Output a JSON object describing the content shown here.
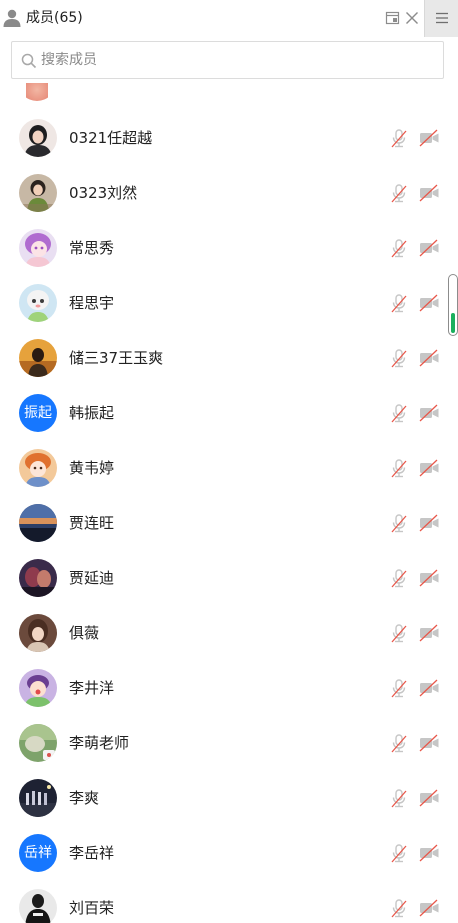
{
  "header": {
    "title": "成员(65)"
  },
  "search": {
    "placeholder": "搜索成员"
  },
  "members": [
    {
      "name": "0321任超越",
      "avatar_text": "",
      "mic_muted": true,
      "camera_off": true
    },
    {
      "name": "0323刘然",
      "avatar_text": "",
      "mic_muted": true,
      "camera_off": true
    },
    {
      "name": "常思秀",
      "avatar_text": "",
      "mic_muted": true,
      "camera_off": true
    },
    {
      "name": "程思宇",
      "avatar_text": "",
      "mic_muted": true,
      "camera_off": true
    },
    {
      "name": "储三37王玉爽",
      "avatar_text": "",
      "mic_muted": true,
      "camera_off": true
    },
    {
      "name": "韩振起",
      "avatar_text": "振起",
      "mic_muted": true,
      "camera_off": true
    },
    {
      "name": "黄韦婷",
      "avatar_text": "",
      "mic_muted": true,
      "camera_off": true
    },
    {
      "name": "贾连旺",
      "avatar_text": "",
      "mic_muted": true,
      "camera_off": true
    },
    {
      "name": "贾延迪",
      "avatar_text": "",
      "mic_muted": true,
      "camera_off": true
    },
    {
      "name": "俱薇",
      "avatar_text": "",
      "mic_muted": true,
      "camera_off": true
    },
    {
      "name": "李井洋",
      "avatar_text": "",
      "mic_muted": true,
      "camera_off": true
    },
    {
      "name": "李萌老师",
      "avatar_text": "",
      "mic_muted": true,
      "camera_off": true
    },
    {
      "name": "李爽",
      "avatar_text": "",
      "mic_muted": true,
      "camera_off": true
    },
    {
      "name": "李岳祥",
      "avatar_text": "岳祥",
      "mic_muted": true,
      "camera_off": true
    },
    {
      "name": "刘百荣",
      "avatar_text": "",
      "mic_muted": true,
      "camera_off": true
    }
  ],
  "icons": {
    "header_person": "person-icon",
    "popout": "popout-window-icon",
    "close": "close-icon",
    "menu": "hamburger-menu-icon",
    "search": "search-icon",
    "mic": "microphone-muted-icon",
    "camera": "camera-off-icon"
  },
  "colors": {
    "avatar_text_bg": "#1677ff",
    "muted_slash": "#e8574a",
    "icon_gray": "#c6c6c6",
    "scroll_thumb": "#1aaf5d"
  }
}
